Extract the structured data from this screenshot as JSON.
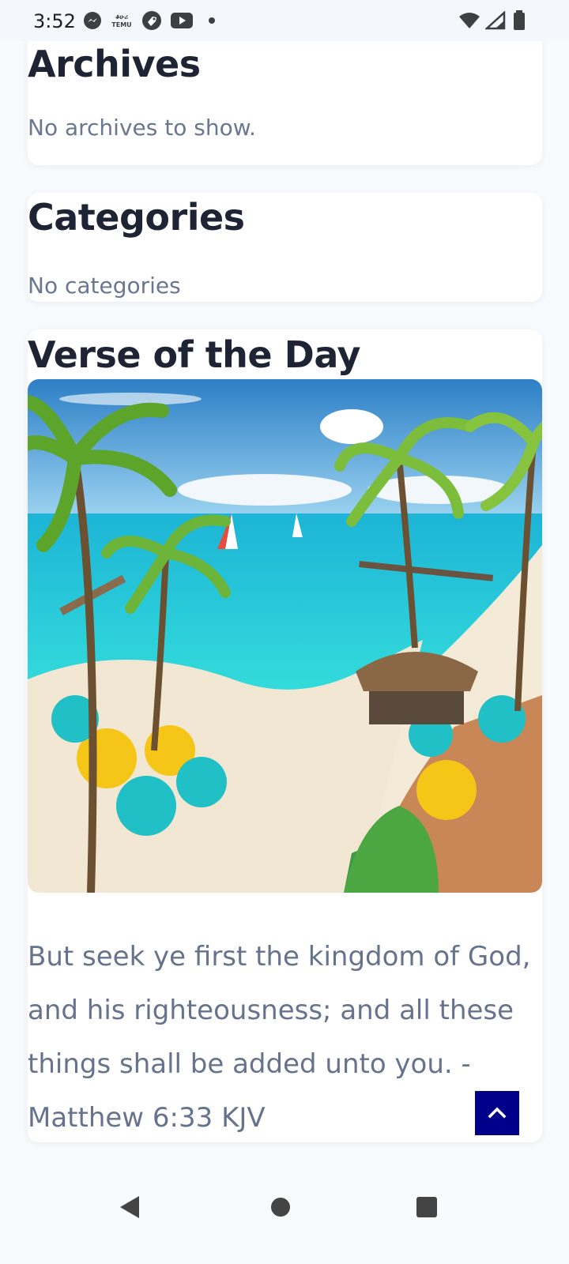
{
  "status_bar": {
    "time": "3:52",
    "left_icons": [
      "messenger-icon",
      "temu-icon",
      "tag-icon",
      "youtube-icon",
      "dot-icon"
    ],
    "right_icons": [
      "wifi-icon",
      "signal-icon",
      "battery-icon"
    ]
  },
  "archives": {
    "title": "Archives",
    "text": "No archives to show."
  },
  "categories": {
    "title": "Categories",
    "text": "No categories"
  },
  "verse_of_day": {
    "title": "Verse of the Day",
    "image_alt": "tropical beach resort illustration",
    "verse": "But seek ye first the kingdom of God, and his righteousness; and all these things shall be added unto you. - Matthew 6:33 KJV"
  },
  "back_to_top": {
    "icon": "chevron-up-icon"
  },
  "nav_bar": {
    "icons": [
      "back-icon",
      "home-icon",
      "recents-icon"
    ]
  },
  "colors": {
    "accent": "#00008b",
    "title": "#1e2433",
    "muted": "#6b7790"
  }
}
